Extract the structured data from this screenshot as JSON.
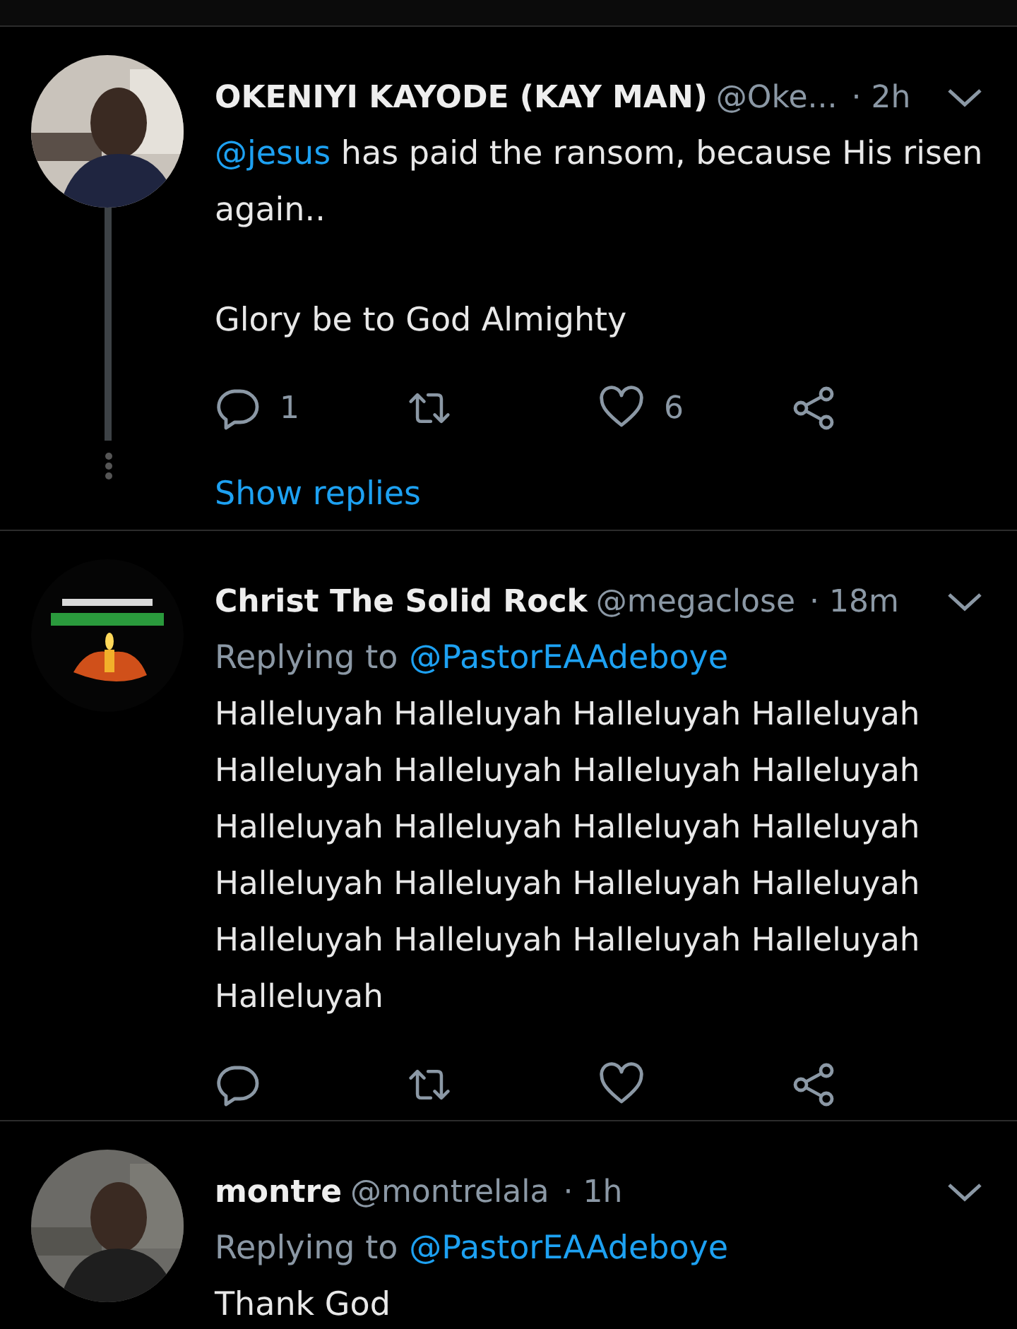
{
  "tweets": [
    {
      "avatar": {
        "kind": "picture"
      },
      "name": "OKENIYI KAYODE (KAY MAN)",
      "handle": "@Oke...",
      "time": "· 2h",
      "body": [
        [
          {
            "kind": "mention",
            "text": "@jesus"
          },
          {
            "kind": "text",
            "text": " has paid the ransom, because His risen again.."
          }
        ],
        [
          {
            "kind": "text",
            "text": "Glory be to God Almighty"
          }
        ]
      ],
      "actions": [
        {
          "kind": "reply",
          "count": "1"
        },
        {
          "kind": "retweet"
        },
        {
          "kind": "like",
          "count": "6"
        },
        {
          "kind": "share"
        }
      ],
      "show_replies": "Show replies"
    },
    {
      "avatar": {
        "kind": "picture"
      },
      "name": "Christ The Solid Rock",
      "handle": "@megaclose",
      "time": "· 18m",
      "replying_to": {
        "label": "Replying to",
        "mention": "@PastorEAAdeboye"
      },
      "body": [
        [
          {
            "kind": "text",
            "text": "Halleluyah Halleluyah Halleluyah Halleluyah Halleluyah Halleluyah Halleluyah Halleluyah Halleluyah Halleluyah Halleluyah Halleluyah Halleluyah Halleluyah Halleluyah Halleluyah Halleluyah Halleluyah Halleluyah Halleluyah Halleluyah"
          }
        ]
      ],
      "actions": [
        {
          "kind": "reply"
        },
        {
          "kind": "retweet"
        },
        {
          "kind": "like"
        },
        {
          "kind": "share"
        }
      ]
    },
    {
      "avatar": {
        "kind": "picture"
      },
      "name": "montre",
      "handle": "@montrelala",
      "time": "· 1h",
      "replying_to": {
        "label": "Replying to",
        "mention": "@PastorEAAdeboye"
      },
      "body": [
        [
          {
            "kind": "text",
            "text": "Thank God"
          }
        ]
      ]
    }
  ]
}
